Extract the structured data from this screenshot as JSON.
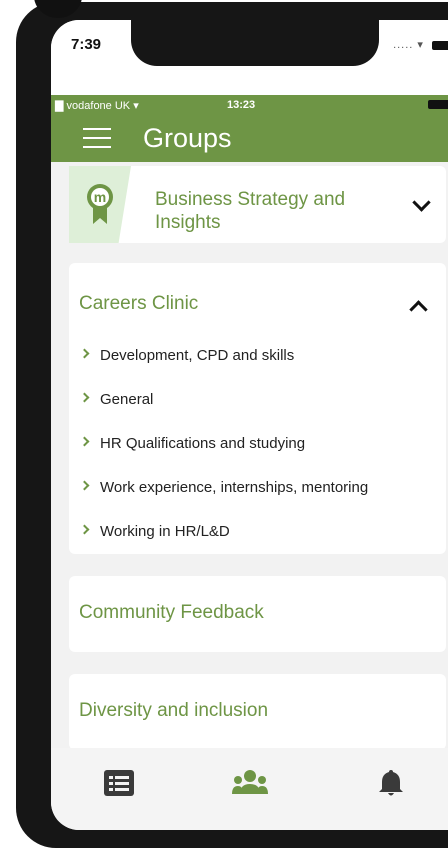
{
  "device_status": {
    "time": "7:39",
    "signal_dots": "....."
  },
  "app_status": {
    "carrier": "vodafone UK",
    "time": "13:23"
  },
  "header": {
    "title": "Groups"
  },
  "groups": [
    {
      "title": "Business Strategy and Insights",
      "expanded": false,
      "badge_letter": "m"
    },
    {
      "title": "Careers Clinic",
      "expanded": true,
      "items": [
        "Development, CPD and skills",
        "General",
        "HR Qualifications and studying",
        "Work experience, internships, mentoring",
        "Working in HR/L&D"
      ]
    },
    {
      "title": "Community Feedback",
      "expanded": false
    },
    {
      "title": "Diversity and inclusion",
      "expanded": false
    }
  ],
  "tabbar": {
    "tabs": [
      {
        "icon": "list-icon",
        "active": false
      },
      {
        "icon": "groups-icon",
        "active": true
      },
      {
        "icon": "bell-icon",
        "active": false
      }
    ]
  },
  "colors": {
    "accent": "#6e9545",
    "badge_bg": "#deefd8",
    "screen_bg": "#f2f2f2"
  }
}
